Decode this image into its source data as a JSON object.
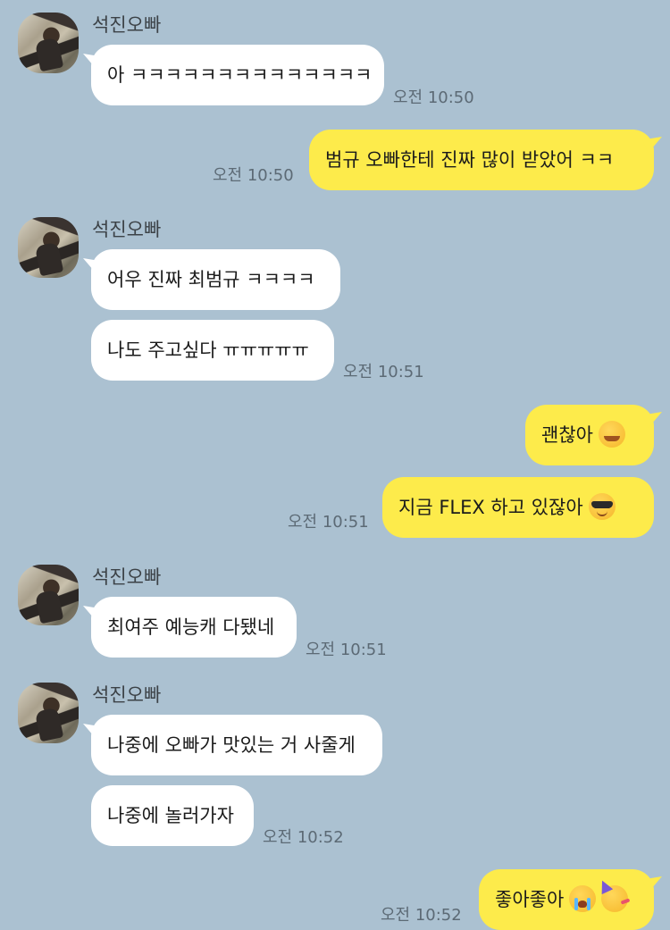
{
  "sender_name": "석진오빠",
  "messages": [
    {
      "text": "아 ㅋㅋㅋㅋㅋㅋㅋㅋㅋㅋㅋㅋㅋㅋ",
      "time": "오전 10:50"
    },
    {
      "text": "범규 오빠한테 진짜 많이 받았어 ㅋㅋ",
      "time": "오전 10:50"
    },
    {
      "text": "어우 진짜 최범규 ㅋㅋㅋㅋ"
    },
    {
      "text": "나도 주고싶다 ㅠㅠㅠㅠㅠ",
      "time": "오전 10:51"
    },
    {
      "text": "괜찮아",
      "emoji": "smiling-face-with-open-hands"
    },
    {
      "text": "지금 FLEX 하고 있잖아",
      "emoji": "smiling-face-with-sunglasses",
      "time": "오전 10:51"
    },
    {
      "text": "최여주 예능캐 다됐네",
      "time": "오전 10:51"
    },
    {
      "text": "나중에 오빠가 맛있는 거 사줄게"
    },
    {
      "text": "나중에 놀러가자",
      "time": "오전 10:52"
    },
    {
      "text": "좋아좋아",
      "emoji": [
        "loudly-crying-face",
        "partying-face"
      ],
      "time": "오전 10:52"
    }
  ],
  "colors": {
    "background": "#abc1d1",
    "incoming_bubble": "#ffffff",
    "outgoing_bubble": "#fdeb4b"
  }
}
